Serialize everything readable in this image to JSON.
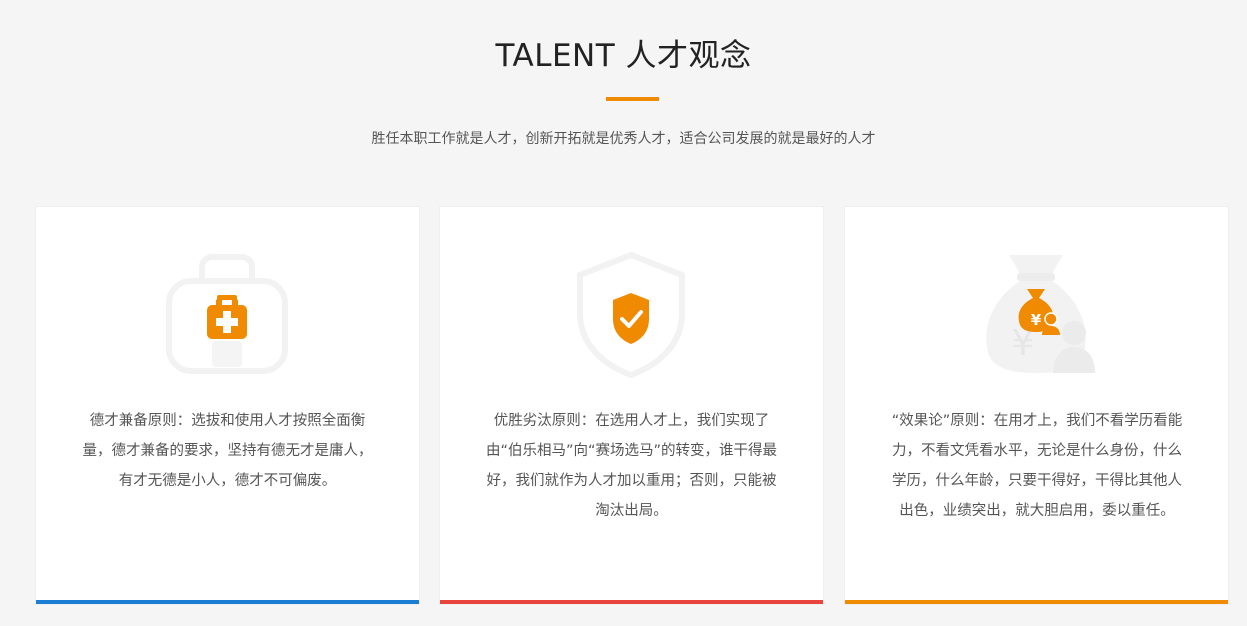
{
  "header": {
    "title": "TALENT 人才观念",
    "subtitle": "胜任本职工作就是人才，创新开拓就是优秀人才，适合公司发展的就是最好的人才"
  },
  "cards": [
    {
      "icon": "first-aid-kit-icon",
      "text": "德才兼备原则：选拔和使用人才按照全面衡量，德才兼备的要求，坚持有德无才是庸人，有才无德是小人，德才不可偏废。",
      "accent": "#1a7fd4"
    },
    {
      "icon": "shield-check-icon",
      "text": "优胜劣汰原则：在选用人才上，我们实现了由“伯乐相马”向“赛场选马”的转变，谁干得最好，我们就作为人才加以重用；否则，只能被淘汰出局。",
      "accent": "#e8453c"
    },
    {
      "icon": "money-bag-icon",
      "text": "“效果论”原则：在用才上，我们不看学历看能力，不看文凭看水平，无论是什么身份，什么学历，什么年龄，只要干得好，干得比其他人出色，业绩突出，就大胆启用，委以重任。",
      "accent": "#f08a00"
    }
  ],
  "colors": {
    "orange": "#f08a00",
    "icon_ghost": "#f2f2f2",
    "background": "#f5f5f5"
  }
}
